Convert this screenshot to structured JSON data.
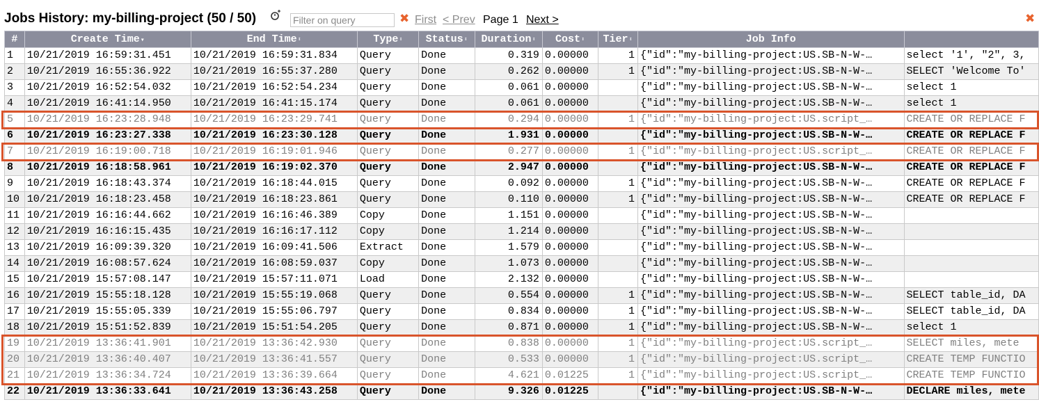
{
  "header": {
    "title": "Jobs History: my-billing-project (50 / 50)",
    "filter_placeholder": "Filter on query",
    "first_label": "First",
    "prev_label": "< Prev",
    "page_label": "Page 1",
    "next_label": "Next >",
    "clear_icon": "close-icon",
    "close_icon": "close-icon"
  },
  "colors": {
    "header_bg": "#8b8d9c",
    "highlight": "#d9542b",
    "accent": "#e8632e"
  },
  "columns": [
    {
      "label": "#",
      "sort": "none"
    },
    {
      "label": "Create Time",
      "sort": "desc"
    },
    {
      "label": "End Time",
      "sort": "both"
    },
    {
      "label": "Type",
      "sort": "both"
    },
    {
      "label": "Status",
      "sort": "both"
    },
    {
      "label": "Duration",
      "sort": "both"
    },
    {
      "label": "Cost",
      "sort": "both"
    },
    {
      "label": "Tier",
      "sort": "both"
    },
    {
      "label": "Job Info",
      "sort": "none"
    },
    {
      "label": "",
      "sort": "none"
    }
  ],
  "rows": [
    {
      "n": "1",
      "create": "10/21/2019 16:59:31.451",
      "end": "10/21/2019 16:59:31.834",
      "type": "Query",
      "status": "Done",
      "duration": "0.319",
      "cost": "0.00000",
      "tier": "1",
      "info": "{\"id\":\"my-billing-project:US.SB-N-W-…",
      "query": "select '1', \"2\", 3,",
      "style": ""
    },
    {
      "n": "2",
      "create": "10/21/2019 16:55:36.922",
      "end": "10/21/2019 16:55:37.280",
      "type": "Query",
      "status": "Done",
      "duration": "0.262",
      "cost": "0.00000",
      "tier": "1",
      "info": "{\"id\":\"my-billing-project:US.SB-N-W-…",
      "query": "SELECT 'Welcome To'",
      "style": ""
    },
    {
      "n": "3",
      "create": "10/21/2019 16:52:54.032",
      "end": "10/21/2019 16:52:54.234",
      "type": "Query",
      "status": "Done",
      "duration": "0.061",
      "cost": "0.00000",
      "tier": "",
      "info": "{\"id\":\"my-billing-project:US.SB-N-W-…",
      "query": "select 1",
      "style": ""
    },
    {
      "n": "4",
      "create": "10/21/2019 16:41:14.950",
      "end": "10/21/2019 16:41:15.174",
      "type": "Query",
      "status": "Done",
      "duration": "0.061",
      "cost": "0.00000",
      "tier": "",
      "info": "{\"id\":\"my-billing-project:US.SB-N-W-…",
      "query": "select 1",
      "style": ""
    },
    {
      "n": "5",
      "create": "10/21/2019 16:23:28.948",
      "end": "10/21/2019 16:23:29.741",
      "type": "Query",
      "status": "Done",
      "duration": "0.294",
      "cost": "0.00000",
      "tier": "1",
      "info": "{\"id\":\"my-billing-project:US.script_…",
      "query": "CREATE OR REPLACE F",
      "style": "dim"
    },
    {
      "n": "6",
      "create": "10/21/2019 16:23:27.338",
      "end": "10/21/2019 16:23:30.128",
      "type": "Query",
      "status": "Done",
      "duration": "1.931",
      "cost": "0.00000",
      "tier": "",
      "info": "{\"id\":\"my-billing-project:US.SB-N-W-…",
      "query": "CREATE OR REPLACE F",
      "style": "bold"
    },
    {
      "n": "7",
      "create": "10/21/2019 16:19:00.718",
      "end": "10/21/2019 16:19:01.946",
      "type": "Query",
      "status": "Done",
      "duration": "0.277",
      "cost": "0.00000",
      "tier": "1",
      "info": "{\"id\":\"my-billing-project:US.script_…",
      "query": "CREATE OR REPLACE F",
      "style": "dim"
    },
    {
      "n": "8",
      "create": "10/21/2019 16:18:58.961",
      "end": "10/21/2019 16:19:02.370",
      "type": "Query",
      "status": "Done",
      "duration": "2.947",
      "cost": "0.00000",
      "tier": "",
      "info": "{\"id\":\"my-billing-project:US.SB-N-W-…",
      "query": "CREATE OR REPLACE F",
      "style": "bold"
    },
    {
      "n": "9",
      "create": "10/21/2019 16:18:43.374",
      "end": "10/21/2019 16:18:44.015",
      "type": "Query",
      "status": "Done",
      "duration": "0.092",
      "cost": "0.00000",
      "tier": "1",
      "info": "{\"id\":\"my-billing-project:US.SB-N-W-…",
      "query": "CREATE OR REPLACE F",
      "style": ""
    },
    {
      "n": "10",
      "create": "10/21/2019 16:18:23.458",
      "end": "10/21/2019 16:18:23.861",
      "type": "Query",
      "status": "Done",
      "duration": "0.110",
      "cost": "0.00000",
      "tier": "1",
      "info": "{\"id\":\"my-billing-project:US.SB-N-W-…",
      "query": "CREATE OR REPLACE F",
      "style": ""
    },
    {
      "n": "11",
      "create": "10/21/2019 16:16:44.662",
      "end": "10/21/2019 16:16:46.389",
      "type": "Copy",
      "status": "Done",
      "duration": "1.151",
      "cost": "0.00000",
      "tier": "",
      "info": "{\"id\":\"my-billing-project:US.SB-N-W-…",
      "query": "",
      "style": ""
    },
    {
      "n": "12",
      "create": "10/21/2019 16:16:15.435",
      "end": "10/21/2019 16:16:17.112",
      "type": "Copy",
      "status": "Done",
      "duration": "1.214",
      "cost": "0.00000",
      "tier": "",
      "info": "{\"id\":\"my-billing-project:US.SB-N-W-…",
      "query": "",
      "style": ""
    },
    {
      "n": "13",
      "create": "10/21/2019 16:09:39.320",
      "end": "10/21/2019 16:09:41.506",
      "type": "Extract",
      "status": "Done",
      "duration": "1.579",
      "cost": "0.00000",
      "tier": "",
      "info": "{\"id\":\"my-billing-project:US.SB-N-W-…",
      "query": "",
      "style": ""
    },
    {
      "n": "14",
      "create": "10/21/2019 16:08:57.624",
      "end": "10/21/2019 16:08:59.037",
      "type": "Copy",
      "status": "Done",
      "duration": "1.073",
      "cost": "0.00000",
      "tier": "",
      "info": "{\"id\":\"my-billing-project:US.SB-N-W-…",
      "query": "",
      "style": ""
    },
    {
      "n": "15",
      "create": "10/21/2019 15:57:08.147",
      "end": "10/21/2019 15:57:11.071",
      "type": "Load",
      "status": "Done",
      "duration": "2.132",
      "cost": "0.00000",
      "tier": "",
      "info": "{\"id\":\"my-billing-project:US.SB-N-W-…",
      "query": "",
      "style": ""
    },
    {
      "n": "16",
      "create": "10/21/2019 15:55:18.128",
      "end": "10/21/2019 15:55:19.068",
      "type": "Query",
      "status": "Done",
      "duration": "0.554",
      "cost": "0.00000",
      "tier": "1",
      "info": "{\"id\":\"my-billing-project:US.SB-N-W-…",
      "query": "SELECT table_id, DA",
      "style": ""
    },
    {
      "n": "17",
      "create": "10/21/2019 15:55:05.339",
      "end": "10/21/2019 15:55:06.797",
      "type": "Query",
      "status": "Done",
      "duration": "0.834",
      "cost": "0.00000",
      "tier": "1",
      "info": "{\"id\":\"my-billing-project:US.SB-N-W-…",
      "query": "SELECT table_id, DA",
      "style": ""
    },
    {
      "n": "18",
      "create": "10/21/2019 15:51:52.839",
      "end": "10/21/2019 15:51:54.205",
      "type": "Query",
      "status": "Done",
      "duration": "0.871",
      "cost": "0.00000",
      "tier": "1",
      "info": "{\"id\":\"my-billing-project:US.SB-N-W-…",
      "query": "select 1",
      "style": ""
    },
    {
      "n": "19",
      "create": "10/21/2019 13:36:41.901",
      "end": "10/21/2019 13:36:42.930",
      "type": "Query",
      "status": "Done",
      "duration": "0.838",
      "cost": "0.00000",
      "tier": "1",
      "info": "{\"id\":\"my-billing-project:US.script_…",
      "query": "SELECT miles, mete",
      "style": "dim"
    },
    {
      "n": "20",
      "create": "10/21/2019 13:36:40.407",
      "end": "10/21/2019 13:36:41.557",
      "type": "Query",
      "status": "Done",
      "duration": "0.533",
      "cost": "0.00000",
      "tier": "1",
      "info": "{\"id\":\"my-billing-project:US.script_…",
      "query": "CREATE TEMP FUNCTIO",
      "style": "dim"
    },
    {
      "n": "21",
      "create": "10/21/2019 13:36:34.724",
      "end": "10/21/2019 13:36:39.664",
      "type": "Query",
      "status": "Done",
      "duration": "4.621",
      "cost": "0.01225",
      "tier": "1",
      "info": "{\"id\":\"my-billing-project:US.script_…",
      "query": "CREATE TEMP FUNCTIO",
      "style": "dim"
    },
    {
      "n": "22",
      "create": "10/21/2019 13:36:33.641",
      "end": "10/21/2019 13:36:43.258",
      "type": "Query",
      "status": "Done",
      "duration": "9.326",
      "cost": "0.01225",
      "tier": "",
      "info": "{\"id\":\"my-billing-project:US.SB-N-W-…",
      "query": "DECLARE miles, mete",
      "style": "bold"
    }
  ],
  "highlighted_row_groups": [
    [
      "5"
    ],
    [
      "7"
    ],
    [
      "19",
      "20",
      "21"
    ]
  ]
}
